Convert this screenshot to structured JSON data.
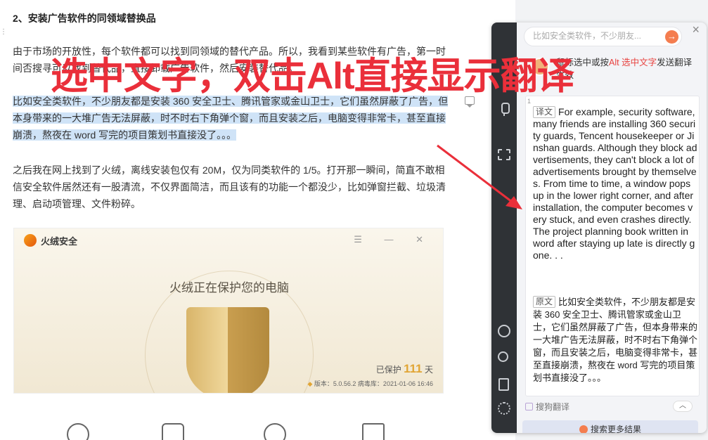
{
  "article": {
    "heading": "2、安装广告软件的同领域替换品",
    "p1": "由于市场的开放性，每个软件都可以找到同领域的替代产品。所以，我看到某些软件有广告，第一时间否搜寻可以找到替代品，直接卸载广告软件，然后安装替代品。",
    "p2": "比如安全类软件，不少朋友都是安装 360 安全卫士、腾讯管家或金山卫士，它们虽然屏蔽了广告，但本身带来的一大堆广告无法屏蔽，时不时右下角弹个窗，而且安装之后，电脑变得非常卡，甚至直接崩溃，熬夜在 word 写完的项目策划书直接没了。。。",
    "p3": "之后我在网上找到了火绒，离线安装包仅有 20M，仅为同类软件的 1/5。打开那一瞬间，简直不敢相信安全软件居然还有一股清流，不仅界面简洁，而且该有的功能一个都没少，比如弹窗拦截、垃圾清理、启动项管理、文件粉碎。"
  },
  "screenshot": {
    "app_name": "火绒安全",
    "controls": "☰ — ✕",
    "status": "火绒正在保护您的电脑",
    "protect_label": "已保护",
    "protect_days": "111",
    "protect_unit": "天",
    "version": "版本：5.0.56.2  病毒库：2021-01-06 16:46"
  },
  "caption": "选中文字，双击Alt直接显示翻译",
  "translator": {
    "search_placeholder": "比如安全类软件，不少朋友...",
    "search_arrow": "→",
    "close": "×",
    "tip_pre": "鼠标",
    "tip_mid": "选中或按",
    "tip_key": "Alt 选中文字",
    "tip_post": "发送翻译生效",
    "card_index": "1",
    "trans_label": "译文",
    "translation": "For example, security software, many friends are installing 360 security guards, Tencent housekeeper or Jinshan guards. Although they block advertisements, they can't block a lot of advertisements brought by themselves. From time to time, a window pops up in the lower right corner, and after installation, the computer becomes very stuck, and even crashes directly. The project planning book written in word after staying up late is directly gone. . .",
    "orig_label": "原文",
    "original": "比如安全类软件，不少朋友都是安装 360 安全卫士、腾讯管家或金山卫士，它们虽然屏蔽了广告，但本身带来的一大堆广告无法屏蔽，时不时右下角弹个窗，而且安装之后，电脑变得非常卡，甚至直接崩溃，熬夜在 word 写完的项目策划书直接没了。。。",
    "provider": "搜狗翻译",
    "collapse": "︿",
    "more": "搜索更多结果"
  },
  "colors": {
    "caption": "#ea2f3a",
    "highlight": "#cfe3f7",
    "rail": "#2f3236",
    "accent": "#f47d4f"
  }
}
